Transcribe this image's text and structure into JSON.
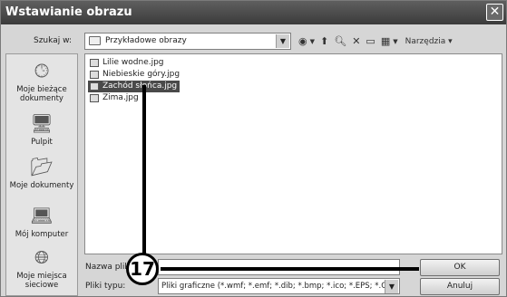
{
  "window": {
    "title": "Wstawianie obrazu"
  },
  "lookin": {
    "label": "Szukaj w:",
    "value": "Przykładowe obrazy"
  },
  "toolbar": {
    "tools_label": "Narzędzia"
  },
  "places": [
    {
      "label": "Moje bieżące dokumenty",
      "icon": "recent-documents-icon"
    },
    {
      "label": "Pulpit",
      "icon": "desktop-icon"
    },
    {
      "label": "Moje dokumenty",
      "icon": "my-documents-icon"
    },
    {
      "label": "Mój komputer",
      "icon": "my-computer-icon"
    },
    {
      "label": "Moje miejsca sieciowe",
      "icon": "network-places-icon"
    }
  ],
  "files": [
    {
      "name": "Lilie wodne.jpg",
      "selected": false
    },
    {
      "name": "Niebieskie góry.jpg",
      "selected": false
    },
    {
      "name": "Zachód słońca.jpg",
      "selected": true
    },
    {
      "name": "Zima.jpg",
      "selected": false
    }
  ],
  "filename": {
    "label": "Nazwa pliku",
    "value": ""
  },
  "filetype": {
    "label": "Pliki typu:",
    "value": "Pliki graficzne (*.wmf; *.emf; *.dib; *.bmp; *.ico; *.EPS; *.GIF"
  },
  "buttons": {
    "ok": "OK",
    "cancel": "Anuluj"
  },
  "callout": {
    "number": "17"
  }
}
